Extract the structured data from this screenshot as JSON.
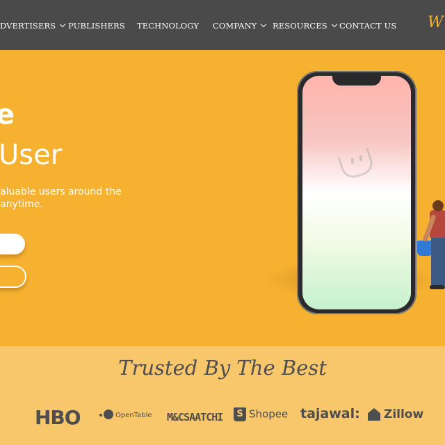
{
  "nav": {
    "items": [
      "DVERTISERS",
      "PUBLISHERS",
      "TECHNOLOGY",
      "COMPANY",
      "RESOURCES",
      "CONTACT US"
    ],
    "logo_fragment": "W"
  },
  "hero": {
    "heading_line1": "e",
    "heading_line2": "User",
    "subtext_line1": "aluable users around the",
    "subtext_line2": "anytime."
  },
  "trusted": {
    "title": "Trusted By The Best",
    "brands": [
      "HBO",
      "OpenTable",
      "M&CSAATCHI",
      "Shopee",
      "tajawal:",
      "Zillow"
    ]
  },
  "colors": {
    "nav_bg": "#4b4a4b",
    "hero_bg": "#f6b130",
    "trusted_bg": "#f8c66b",
    "brand_text": "#4e4e4e"
  }
}
